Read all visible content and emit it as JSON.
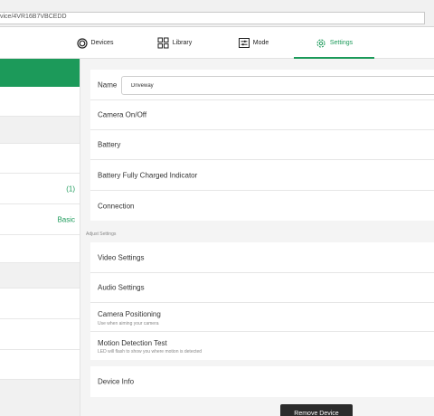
{
  "browser": {
    "url": "vice/4VR16B7VBCEDD"
  },
  "tabs": [
    {
      "label": "Devices",
      "icon": "devices-icon"
    },
    {
      "label": "Library",
      "icon": "library-icon"
    },
    {
      "label": "Mode",
      "icon": "mode-icon"
    },
    {
      "label": "Settings",
      "icon": "gear-icon"
    }
  ],
  "left_pane": {
    "count": "(1)",
    "plan": "Basic"
  },
  "settings": {
    "name_label": "Name",
    "name_value": "Driveway",
    "camera_onoff": "Camera On/Off",
    "battery": "Battery",
    "battery_indicator": "Battery Fully Charged Indicator",
    "connection": "Connection",
    "adjust_label": "Adjust Settings",
    "video": "Video Settings",
    "audio": "Audio Settings",
    "positioning": "Camera Positioning",
    "positioning_sub": "Use when aiming your camera",
    "motion": "Motion Detection Test",
    "motion_sub": "LED will flash to show you where motion is detected",
    "device_info": "Device Info",
    "remove": "Remove Device"
  },
  "colors": {
    "accent": "#1c9a5a",
    "button_dark": "#2b2b2b"
  }
}
